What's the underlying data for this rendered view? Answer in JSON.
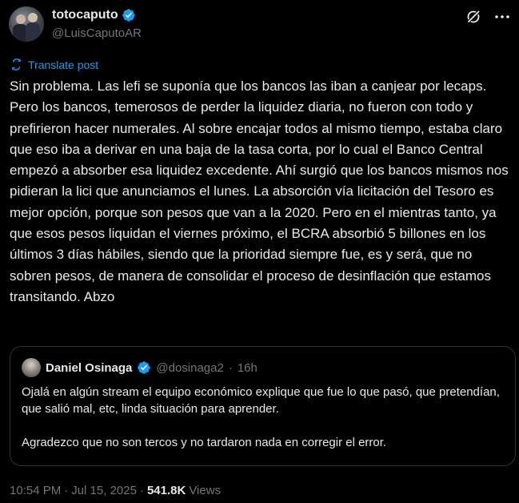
{
  "author": {
    "display_name": "totocaputo",
    "handle": "@LuisCaputoAR"
  },
  "translate_label": "Translate post",
  "post_text": "Sin problema. Las lefi se suponía que los bancos las iban a canjear por lecaps. Pero los bancos, temerosos de perder la liquidez diaria, no fueron con todo y prefirieron hacer numerales. Al sobre encajar todos al mismo tiempo, estaba claro que eso iba a derivar en una baja de la tasa corta, por lo cual el Banco Central  empezó a absorber esa liquidez excedente. Ahí surgió que los bancos mismos nos pidieran la lici que anunciamos el lunes. La absorción vía licitación del Tesoro es mejor opción, porque son pesos que van a la 2020. Pero en el mientras tanto, ya que esos pesos liquidan el viernes próximo, el BCRA absorbió 5 billones en los últimos 3 días hábiles, siendo que la prioridad siempre fue, es y será, que no sobren pesos, de manera de consolidar el proceso de desinflación que estamos transitando. Abzo",
  "quote": {
    "display_name": "Daniel Osinaga",
    "handle": "@dosinaga2",
    "separator": "·",
    "time": "16h",
    "paragraph1": "Ojalá en algún stream el equipo económico explique que fue lo que pasó, que pretendían, que salió mal, etc, linda situación para aprender.",
    "paragraph2": "Agradezco que no son tercos y no tardaron nada en corregir el error."
  },
  "meta": {
    "time": "10:54 PM",
    "sep1": "·",
    "date": "Jul 15, 2025",
    "sep2": "·",
    "views_count": "541.8K",
    "views_label": "Views"
  },
  "colors": {
    "background": "#000000",
    "text": "#e7e9ea",
    "muted": "#71767b",
    "accent": "#1d9bf0",
    "border": "#2f3336"
  },
  "icons": {
    "verified": "verified-badge-icon",
    "grok": "grok-icon",
    "more": "more-dots-icon",
    "translate": "translate-icon"
  }
}
